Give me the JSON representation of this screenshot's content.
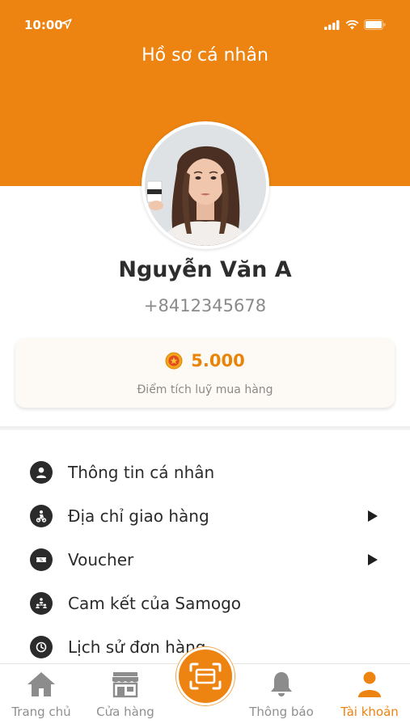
{
  "status_bar": {
    "time": "10:00"
  },
  "header": {
    "title": "Hồ sơ cá nhân"
  },
  "profile": {
    "name": "Nguyễn Văn A",
    "phone": "+8412345678"
  },
  "points": {
    "value": "5.000",
    "label": "Điểm tích luỹ mua hàng"
  },
  "menu": {
    "items": [
      {
        "label": "Thông tin cá nhân",
        "icon": "user-icon",
        "has_arrow": false
      },
      {
        "label": "Địa chỉ giao hàng",
        "icon": "delivery-icon",
        "has_arrow": true
      },
      {
        "label": "Voucher",
        "icon": "voucher-icon",
        "has_arrow": true
      },
      {
        "label": "Cam kết của Samogo",
        "icon": "commitment-icon",
        "has_arrow": false
      },
      {
        "label": "Lịch sử đơn hàng",
        "icon": "history-icon",
        "has_arrow": false
      }
    ]
  },
  "bottom_nav": {
    "items": [
      {
        "label": "Trang chủ",
        "icon": "home-icon",
        "active": false
      },
      {
        "label": "Cửa hàng",
        "icon": "store-icon",
        "active": false
      },
      {
        "label": "Thông báo",
        "icon": "bell-icon",
        "active": false
      },
      {
        "label": "Tài khoản",
        "icon": "account-icon",
        "active": true
      }
    ],
    "center_action": {
      "icon": "scan-icon"
    }
  },
  "colors": {
    "accent": "#ED8411",
    "text_dark": "#2b2b2b",
    "text_muted": "#8a8a8a"
  }
}
